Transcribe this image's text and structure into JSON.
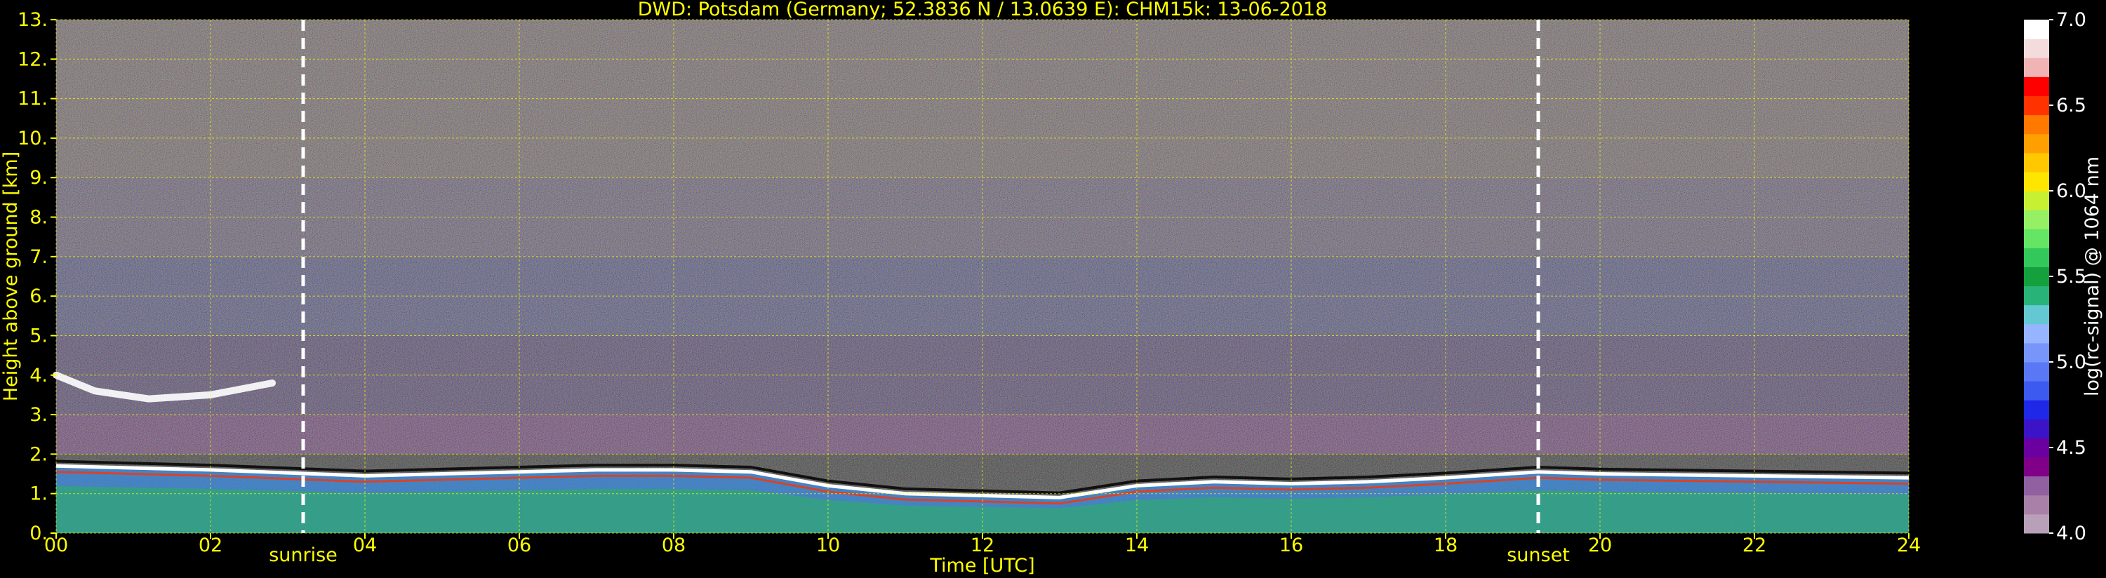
{
  "chart_data": {
    "type": "heatmap",
    "title": "DWD: Potsdam (Germany; 52.3836 N / 13.0639 E):    CHM15k: 13-06-2018",
    "xlabel": "Time [UTC]",
    "ylabel": "Height above ground [km]",
    "xlim": [
      0,
      24
    ],
    "ylim": [
      0,
      13
    ],
    "x_ticks": [
      "00",
      "02",
      "04",
      "06",
      "08",
      "10",
      "12",
      "14",
      "16",
      "18",
      "20",
      "22",
      "24"
    ],
    "y_ticks": [
      "0.",
      "1.",
      "2.",
      "3.",
      "4.",
      "5.",
      "6.",
      "7.",
      "8.",
      "9.",
      "10.",
      "11.",
      "12.",
      "13."
    ],
    "grid": true,
    "grid_color": "#ffff00",
    "annotations": [
      {
        "text": "sunrise",
        "x": 3.2
      },
      {
        "text": "sunset",
        "x": 19.2
      }
    ],
    "colorbar": {
      "label": "log(rc-signal) @ 1064 nm",
      "range": [
        4.0,
        7.0
      ],
      "ticks": [
        "4.0",
        "4.5",
        "5.0",
        "5.5",
        "6.0",
        "6.5",
        "7.0"
      ],
      "colors": [
        "#b8a0b8",
        "#a880a8",
        "#9060a0",
        "#800088",
        "#6a00a0",
        "#3c14c8",
        "#1e28e6",
        "#3c5af0",
        "#5a78f5",
        "#7896fa",
        "#96b4ff",
        "#64c8d2",
        "#28b478",
        "#14a03c",
        "#32c85a",
        "#64e664",
        "#96f064",
        "#c8f032",
        "#ffe600",
        "#ffc800",
        "#ffa000",
        "#ff7800",
        "#ff3200",
        "#ff0000",
        "#f0b4b4",
        "#f5dcdc",
        "#ffffff"
      ]
    },
    "features": {
      "boundary_layer_top_km": [
        [
          0,
          1.7
        ],
        [
          2,
          1.6
        ],
        [
          4,
          1.45
        ],
        [
          6,
          1.55
        ],
        [
          7,
          1.6
        ],
        [
          8,
          1.6
        ],
        [
          9,
          1.55
        ],
        [
          10,
          1.2
        ],
        [
          11,
          1.0
        ],
        [
          12,
          0.95
        ],
        [
          13,
          0.9
        ],
        [
          14,
          1.2
        ],
        [
          15,
          1.3
        ],
        [
          16,
          1.25
        ],
        [
          17,
          1.3
        ],
        [
          18,
          1.4
        ],
        [
          19.2,
          1.55
        ],
        [
          20,
          1.5
        ],
        [
          22,
          1.45
        ],
        [
          24,
          1.4
        ]
      ],
      "cloud_layer_km": [
        [
          0,
          4.0
        ],
        [
          0.5,
          3.6
        ],
        [
          1.2,
          3.4
        ],
        [
          2,
          3.5
        ],
        [
          2.8,
          3.8
        ]
      ]
    }
  }
}
